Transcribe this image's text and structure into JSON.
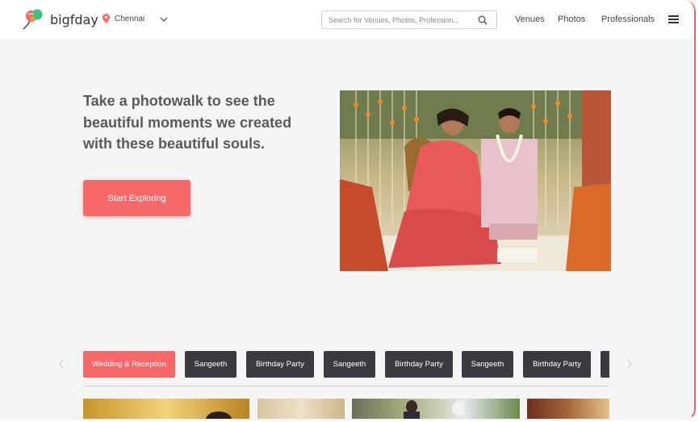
{
  "brand": {
    "name": "bigfday"
  },
  "location": {
    "city": "Chennai"
  },
  "search": {
    "placeholder": "Search for Venues, Photos, Profession..."
  },
  "nav": {
    "items": [
      "Venues",
      "Photos",
      "Professionals"
    ]
  },
  "hero": {
    "lines": [
      "Take a photowalk to see the",
      "beautiful moments we created",
      "with these beautiful souls."
    ],
    "cta_label": "Start Exploring"
  },
  "categories": [
    {
      "label": "Wedding & Reception",
      "active": true
    },
    {
      "label": "Sangeeth",
      "active": false
    },
    {
      "label": "Birthday Party",
      "active": false
    },
    {
      "label": "Sangeeth",
      "active": false
    },
    {
      "label": "Birthday Party",
      "active": false
    },
    {
      "label": "Sangeeth",
      "active": false
    },
    {
      "label": "Birthday Party",
      "active": false
    }
  ],
  "colors": {
    "accent": "#f7686b",
    "chip_dark": "#3b3a40",
    "background": "#f5f5f5"
  }
}
